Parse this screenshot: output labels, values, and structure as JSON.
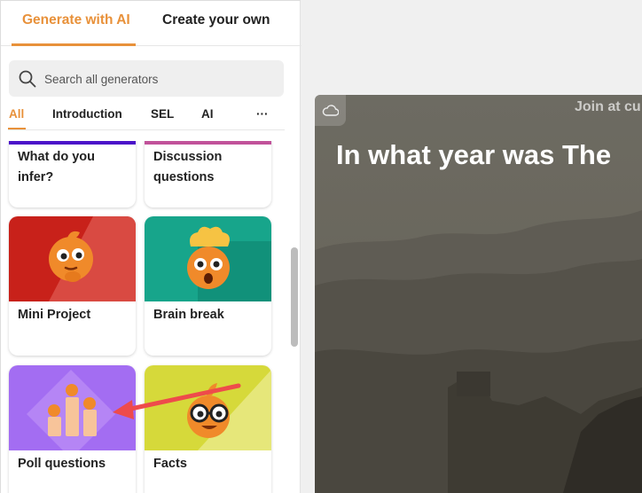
{
  "tabs": {
    "generate_ai": "Generate with AI",
    "create_own": "Create your own"
  },
  "search": {
    "placeholder": "Search all generators"
  },
  "filters": {
    "all": "All",
    "introduction": "Introduction",
    "sel": "SEL",
    "ai": "AI",
    "more": "···"
  },
  "cards": {
    "infer": {
      "label_line1": "What do you",
      "label_line2": "infer?",
      "bar_color": "#4b12c9"
    },
    "discussion": {
      "label_line1": "Discussion",
      "label_line2": "questions",
      "bar_color": "#c1529a"
    },
    "mini_project": {
      "label": "Mini Project",
      "color": "#c8211a"
    },
    "brain_break": {
      "label": "Brain break",
      "color": "#17a58b"
    },
    "poll": {
      "label": "Poll questions",
      "color": "#a36df2"
    },
    "facts": {
      "label": "Facts",
      "color": "#d6d93a"
    }
  },
  "preview": {
    "join_text": "Join at cu",
    "question": "In what year was The"
  },
  "colors": {
    "accent": "#e8913a",
    "annotation_arrow": "#ee4b4b"
  }
}
